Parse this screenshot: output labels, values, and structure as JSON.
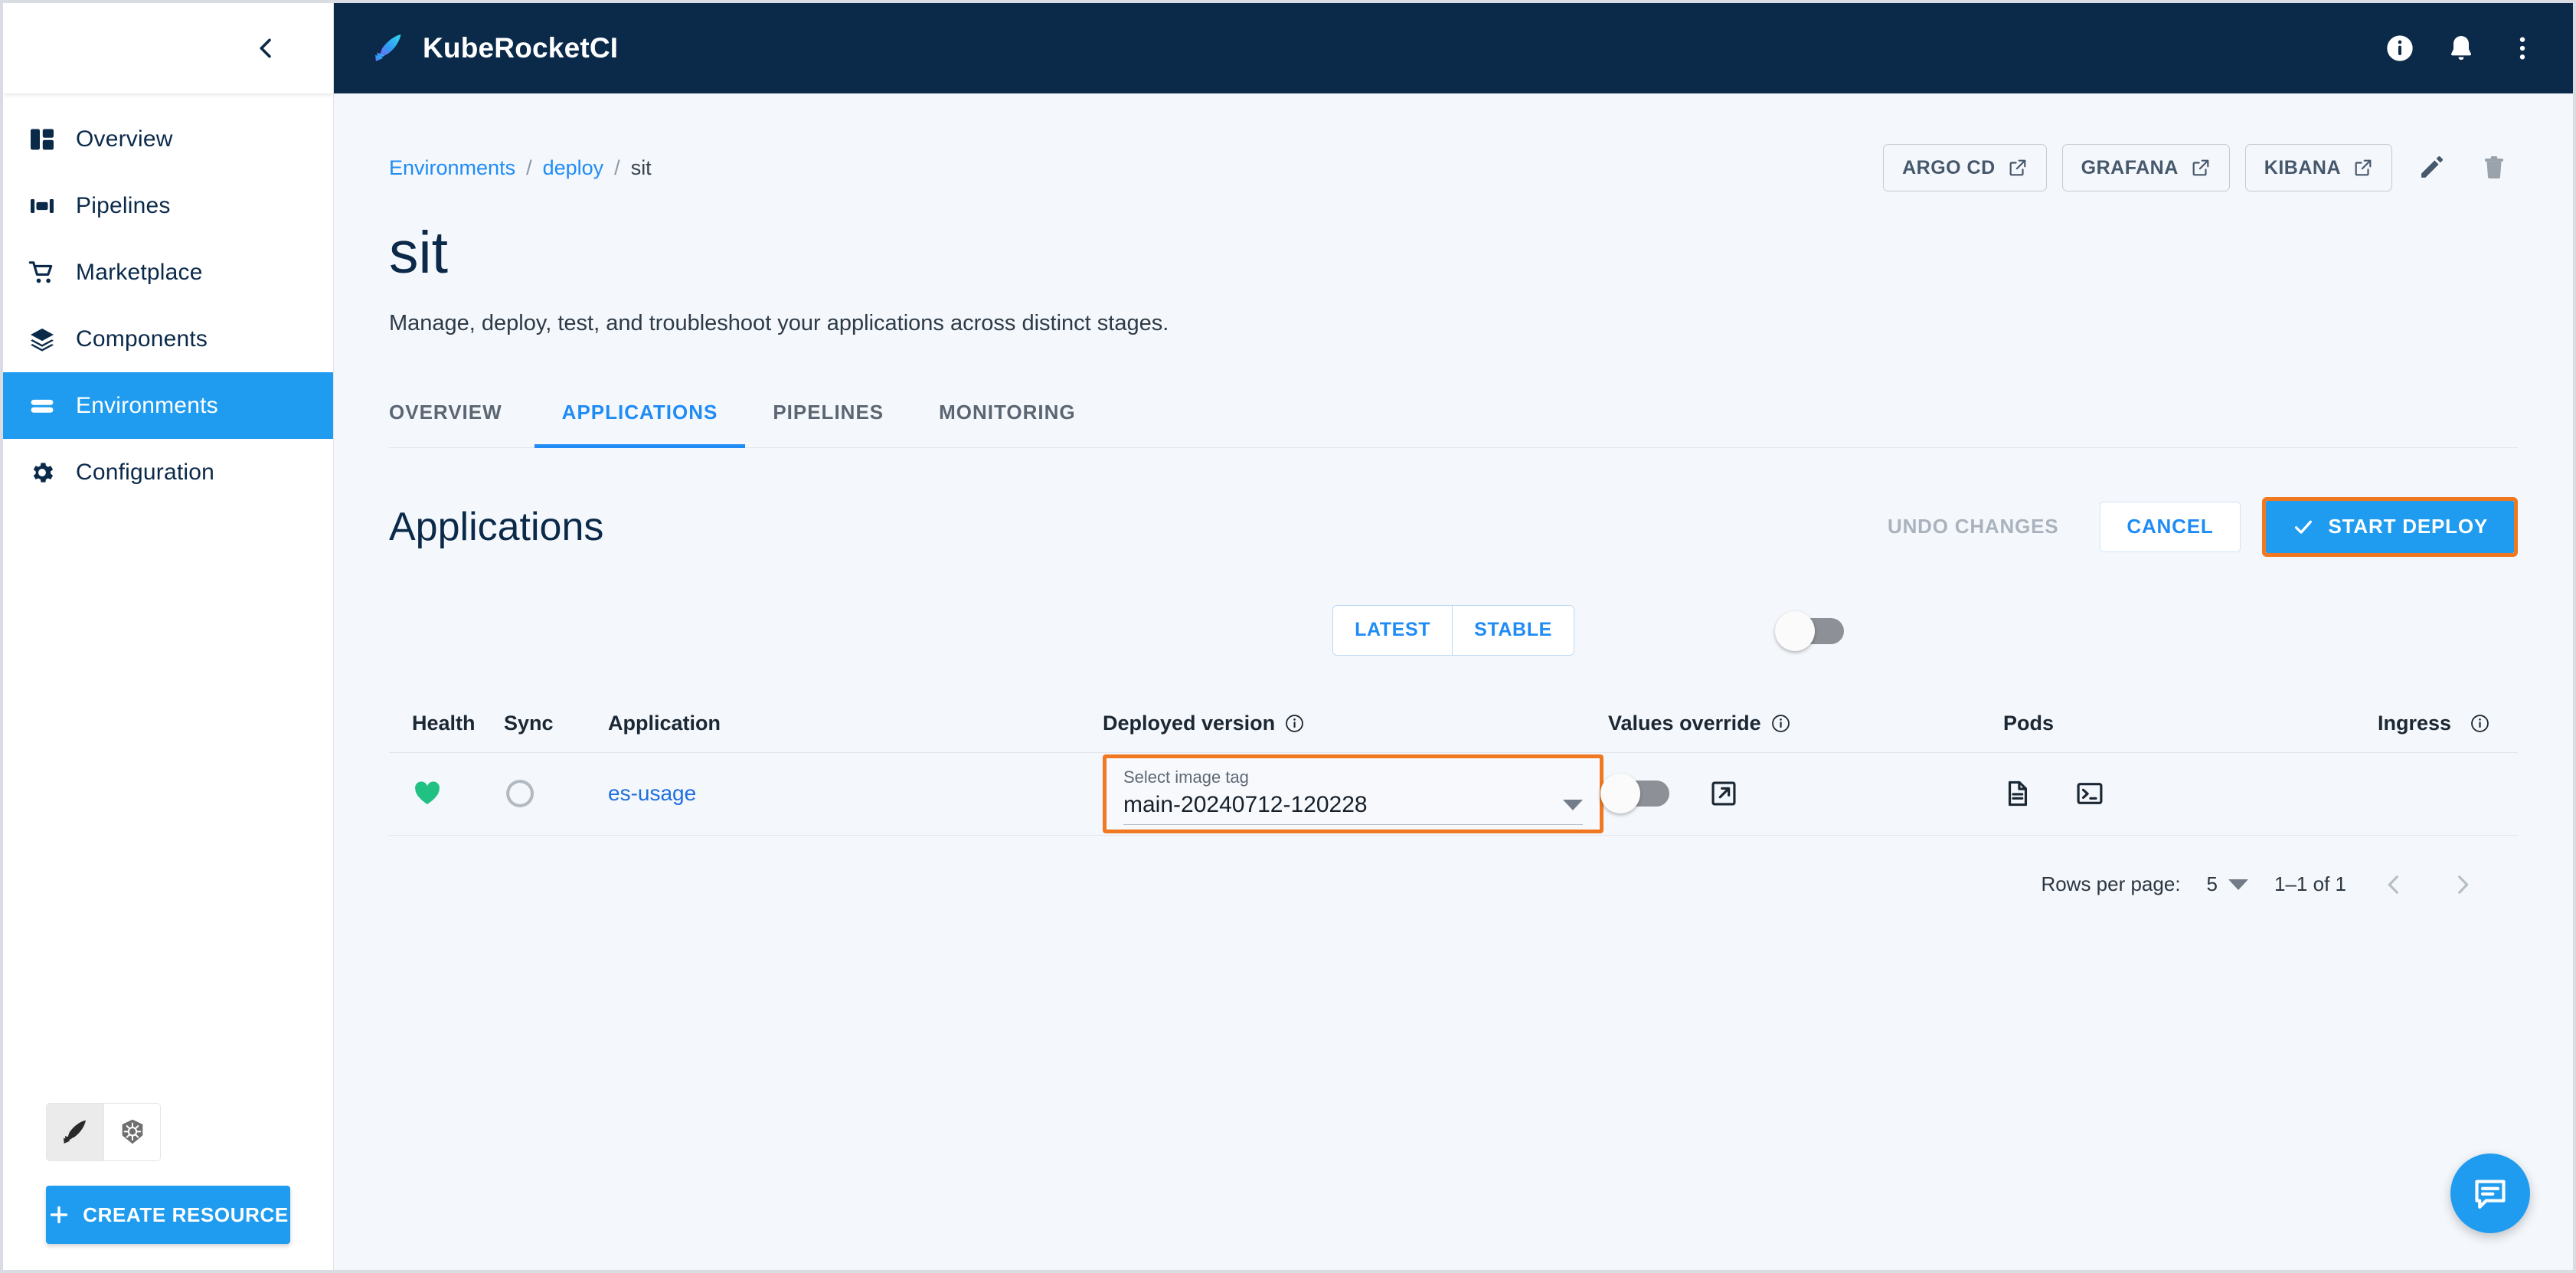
{
  "app": {
    "brand_name": "KubeRocketCI",
    "logo_icon": "rocket-feather-icon",
    "collapse_icon": "chevron-left-icon"
  },
  "topbar": {
    "info_icon": "info-circle-icon",
    "notifications_icon": "bell-icon",
    "more_icon": "more-vertical-icon"
  },
  "sidebar": {
    "items": [
      {
        "label": "Overview",
        "icon": "dashboard-icon",
        "active": false
      },
      {
        "label": "Pipelines",
        "icon": "pipelines-icon",
        "active": false
      },
      {
        "label": "Marketplace",
        "icon": "cart-icon",
        "active": false
      },
      {
        "label": "Components",
        "icon": "layers-icon",
        "active": false
      },
      {
        "label": "Environments",
        "icon": "environments-icon",
        "active": true
      },
      {
        "label": "Configuration",
        "icon": "gear-icon",
        "active": false
      }
    ],
    "mode_switch": [
      {
        "icon": "kuberocketci-icon",
        "selected": true
      },
      {
        "icon": "kubernetes-icon",
        "selected": false
      }
    ],
    "create_button": {
      "label": "CREATE RESOURCE",
      "icon": "plus-icon"
    }
  },
  "breadcrumb": {
    "items": [
      {
        "label": "Environments",
        "link": true
      },
      {
        "label": "deploy",
        "link": true
      },
      {
        "label": "sit",
        "link": false
      }
    ],
    "separator": "/"
  },
  "header_actions": {
    "external_buttons": [
      {
        "label": "ARGO CD",
        "icon": "external-link-icon"
      },
      {
        "label": "GRAFANA",
        "icon": "external-link-icon"
      },
      {
        "label": "KIBANA",
        "icon": "external-link-icon"
      }
    ],
    "edit_icon": "pencil-icon",
    "delete_icon": "trash-icon"
  },
  "page": {
    "title": "sit",
    "description": "Manage, deploy, test, and troubleshoot your applications across distinct stages."
  },
  "tabs": [
    {
      "label": "OVERVIEW",
      "active": false
    },
    {
      "label": "APPLICATIONS",
      "active": true
    },
    {
      "label": "PIPELINES",
      "active": false
    },
    {
      "label": "MONITORING",
      "active": false
    }
  ],
  "panel": {
    "title": "Applications",
    "undo_label": "UNDO CHANGES",
    "cancel_label": "CANCEL",
    "deploy_label": "START DEPLOY",
    "deploy_icon": "check-icon",
    "deploy_highlight_color": "#f07820",
    "primary_color": "#1f9cf0"
  },
  "filters": {
    "segments": [
      {
        "label": "LATEST",
        "selected": false
      },
      {
        "label": "STABLE",
        "selected": false
      }
    ],
    "toggle": {
      "name": "filter-toggle",
      "on": false
    }
  },
  "table": {
    "columns": [
      {
        "key": "health",
        "label": "Health",
        "info": false
      },
      {
        "key": "sync",
        "label": "Sync",
        "info": false
      },
      {
        "key": "application",
        "label": "Application",
        "info": false
      },
      {
        "key": "deployed_version",
        "label": "Deployed version",
        "info": true
      },
      {
        "key": "values_override",
        "label": "Values override",
        "info": true
      },
      {
        "key": "pods",
        "label": "Pods",
        "info": false
      },
      {
        "key": "ingress",
        "label": "Ingress",
        "info": true
      }
    ],
    "rows": [
      {
        "health": {
          "icon": "heart-icon",
          "color": "#21c183",
          "status": "healthy"
        },
        "sync": {
          "icon": "sync-ring-icon",
          "color": "#b3b9c1",
          "status": "unknown"
        },
        "application": "es-usage",
        "deployed_version": {
          "label": "Select image tag",
          "value": "main-20240712-120228",
          "highlighted": true,
          "caret_icon": "chevron-down-icon"
        },
        "values_override": {
          "toggle_on": false,
          "external_icon": "external-link-icon"
        },
        "pods": [
          {
            "icon": "logs-document-icon"
          },
          {
            "icon": "terminal-icon"
          }
        ],
        "ingress": ""
      }
    ]
  },
  "pagination": {
    "rows_per_page_label": "Rows per page:",
    "rows_per_page_value": "5",
    "range_label": "1–1 of 1",
    "prev_icon": "chevron-left-icon",
    "next_icon": "chevron-right-icon"
  },
  "fab": {
    "icon": "chat-bubble-icon",
    "color": "#1f9cf0"
  }
}
